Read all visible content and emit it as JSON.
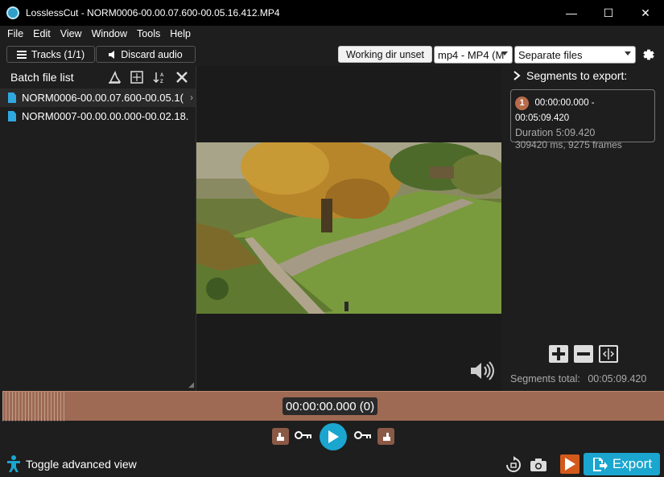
{
  "window": {
    "title": "LosslessCut - NORM0006-00.00.07.600-00.05.16.412.MP4",
    "minimize": "—",
    "maximize": "☐",
    "close": "✕"
  },
  "menu": [
    "File",
    "Edit",
    "View",
    "Window",
    "Tools",
    "Help"
  ],
  "toolbar": {
    "tracks_label": "Tracks (1/1)",
    "discard_audio_label": "Discard audio",
    "working_dir_label": "Working dir unset",
    "format_value": "mp4 - MP4 (M",
    "output_mode_value": "Separate files"
  },
  "batch": {
    "title": "Batch file list",
    "files": [
      "NORM0006-00.00.07.600-00.05.1(",
      "NORM0007-00.00.00.000-00.02.18."
    ]
  },
  "segments": {
    "header": "Segments to export:",
    "items": [
      {
        "number": "1",
        "range": "00:00:00.000 - 00:05:09.420",
        "duration": "Duration 5:09.420",
        "detail": "309420 ms, 9275 frames"
      }
    ],
    "total_label": "Segments total:",
    "total_value": "00:05:09.420"
  },
  "timeline": {
    "current_time": "00:00:00.000 (0)"
  },
  "bottom": {
    "advanced_view_label": "Toggle advanced view",
    "export_label": "Export"
  },
  "colors": {
    "accent": "#1aa6cf",
    "timeline": "#9e6a53",
    "segment_badge": "#b86b4a",
    "mode_button": "#d35a1b"
  },
  "icons": [
    "app-icon",
    "list-icon",
    "speaker-icon",
    "wizard-icon",
    "expand-icon",
    "sort-icon",
    "close-icon",
    "file-icon",
    "chevron-right-icon",
    "volume-icon",
    "add-icon",
    "remove-icon",
    "split-icon",
    "settings-icon",
    "cut-start-icon",
    "key-icon",
    "play-icon",
    "cut-end-icon",
    "accessibility-icon",
    "rotate-icon",
    "camera-icon",
    "export-mode-icon",
    "export-icon"
  ]
}
